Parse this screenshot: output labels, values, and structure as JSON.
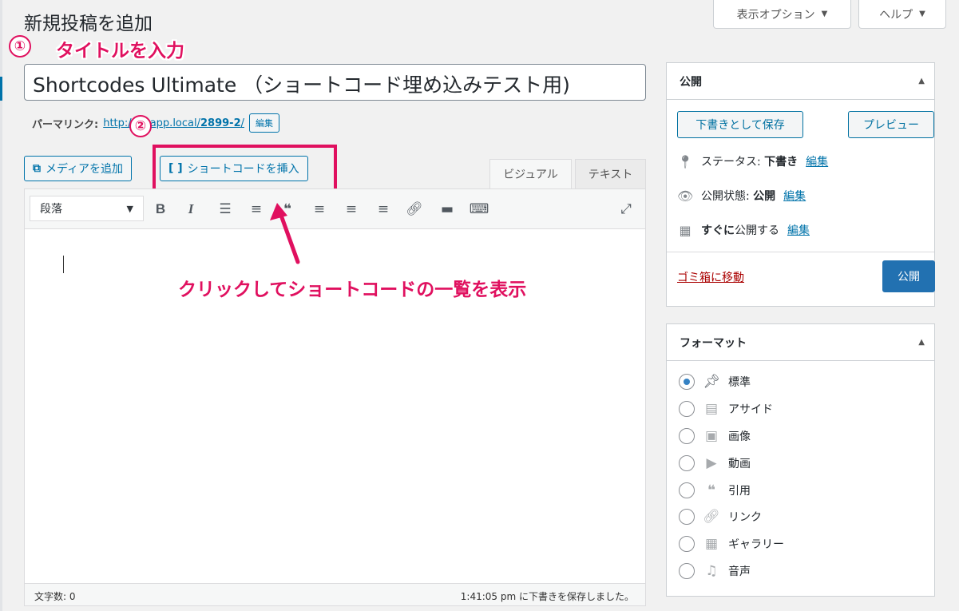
{
  "screen_options": {
    "display_options": "表示オプション",
    "help": "ヘルプ",
    "caret": "▼"
  },
  "page": {
    "title": "新規投稿を追加"
  },
  "annotations": {
    "step1_num": "①",
    "step1_text": "タイトルを入力",
    "step2_num": "②",
    "instruction": "クリックしてショートコードの一覧を表示",
    "color": "#e0105f"
  },
  "post": {
    "title_value": "Shortcodes Ultimate （ショートコード埋め込みテスト用)",
    "permalink_label": "パーマリンク:",
    "permalink_url_prefix": "http://bizapp.local/",
    "permalink_slug": "2899-2",
    "permalink_url_suffix": "/",
    "permalink_edit": "編集"
  },
  "media_buttons": {
    "add_media": "メディアを追加",
    "insert_shortcode": "ショートコードを挿入"
  },
  "editor_tabs": {
    "visual": "ビジュアル",
    "text": "テキスト"
  },
  "toolbar": {
    "format_select": "段落",
    "icons": [
      "bold-icon",
      "italic-icon",
      "bullet-list-icon",
      "numbered-list-icon",
      "blockquote-icon",
      "align-left-icon",
      "align-center-icon",
      "align-right-icon",
      "link-icon",
      "read-more-icon",
      "toolbar-toggle-icon",
      "fullscreen-icon"
    ]
  },
  "status_bar": {
    "word_count": "文字数: 0",
    "autosave": "1:41:05 pm に下書きを保存しました。"
  },
  "publish_box": {
    "title": "公開",
    "save_draft": "下書きとして保存",
    "preview": "プレビュー",
    "status_label": "ステータス:",
    "status_value": "下書き",
    "visibility_label": "公開状態:",
    "visibility_value": "公開",
    "schedule_prefix": "すぐに",
    "schedule_suffix": "公開する",
    "edit": "編集",
    "trash": "ゴミ箱に移動",
    "publish": "公開"
  },
  "format_box": {
    "title": "フォーマット",
    "options": [
      {
        "label": "標準",
        "icon": "pin-icon",
        "selected": true
      },
      {
        "label": "アサイド",
        "icon": "aside-icon",
        "selected": false
      },
      {
        "label": "画像",
        "icon": "image-icon",
        "selected": false
      },
      {
        "label": "動画",
        "icon": "video-icon",
        "selected": false
      },
      {
        "label": "引用",
        "icon": "quote-icon",
        "selected": false
      },
      {
        "label": "リンク",
        "icon": "link-icon",
        "selected": false
      },
      {
        "label": "ギャラリー",
        "icon": "gallery-icon",
        "selected": false
      },
      {
        "label": "音声",
        "icon": "audio-icon",
        "selected": false
      }
    ]
  }
}
